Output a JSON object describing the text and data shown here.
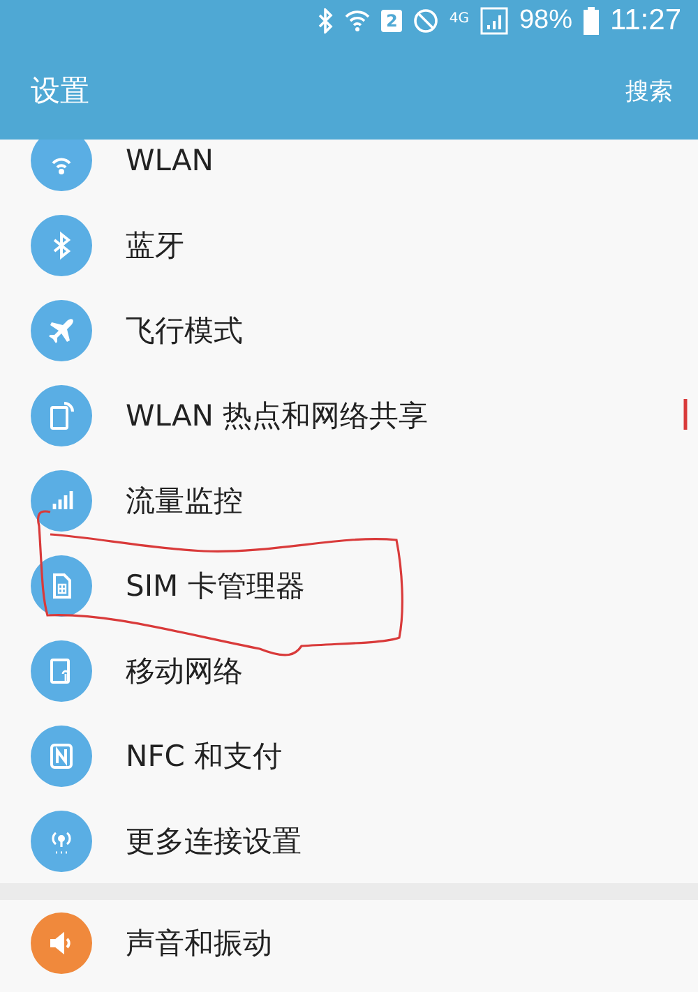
{
  "status_bar": {
    "sim_slot": "2",
    "network": "4G",
    "battery": "98%",
    "time": "11:27"
  },
  "app_bar": {
    "title": "设置",
    "action": "搜索"
  },
  "groups": [
    {
      "items": [
        {
          "label": "WLAN",
          "color": "#5aaee4"
        },
        {
          "label": "蓝牙",
          "color": "#5aaee4"
        },
        {
          "label": "飞行模式",
          "color": "#5aaee4"
        },
        {
          "label": "WLAN 热点和网络共享",
          "color": "#5aaee4"
        },
        {
          "label": "流量监控",
          "color": "#5aaee4"
        },
        {
          "label": "SIM 卡管理器",
          "color": "#5aaee4"
        },
        {
          "label": "移动网络",
          "color": "#5aaee4"
        },
        {
          "label": "NFC 和支付",
          "color": "#5aaee4"
        },
        {
          "label": "更多连接设置",
          "color": "#5aaee4"
        }
      ]
    },
    {
      "items": [
        {
          "label": "声音和振动",
          "color": "#f0893c"
        }
      ]
    }
  ]
}
